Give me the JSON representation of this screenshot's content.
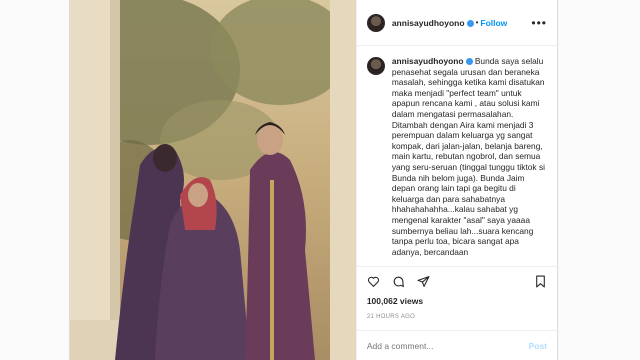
{
  "post": {
    "username": "annisayudhoyono",
    "follow_label": "Follow",
    "caption_text": "Bunda saya selalu penasehat segala urusan dan beraneka masalah, sehingga ketika kami disatukan maka menjadi \"perfect team\" untuk apapun rencana kami , atau solusi kami dalam mengatasi permasalahan. Ditambah dengan Aira kami menjadi 3 perempuan dalam keluarga yg sangat kompak, dari jalan-jalan, belanja bareng, main kartu, rebutan ngobrol, dan semua yang seru-seruan (tinggal tunggu tiktok si Bunda nih belom juga). Bunda Jaim depan orang lain tapi ga begitu di keluarga dan para sahabatnya hhahahahahha...kalau sahabat yg mengenal karakter \"asal\" saya yaaaa sumbernya beliau lah...suara kencang tanpa perlu toa, bicara sangat apa adanya, bercandaan",
    "views": "100,062 views",
    "timestamp": "21 HOURS AGO",
    "comment_placeholder": "Add a comment...",
    "post_label": "Post"
  },
  "icons": {
    "more": "more-options-icon",
    "like": "heart-icon",
    "comment": "comment-icon",
    "share": "share-icon",
    "save": "bookmark-icon",
    "verified": "verified-badge-icon"
  },
  "colors": {
    "link_blue": "#0095f6",
    "verified_blue": "#3897f0",
    "post_disabled": "#b2dffc"
  }
}
